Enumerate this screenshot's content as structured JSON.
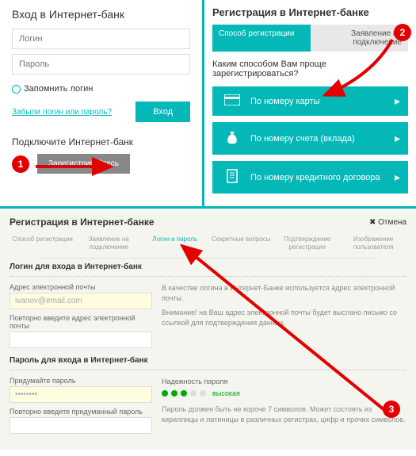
{
  "login": {
    "title": "Вход в Интернет-банк",
    "login_placeholder": "Логин",
    "password_placeholder": "Пароль",
    "remember_label": "Запомнить логин",
    "forgot_link": "Забыли логин или пароль?",
    "login_button": "Вход",
    "connect_text": "Подключите Интернет-банк",
    "register_button": "Зарегистрируйтесь"
  },
  "reg": {
    "title": "Регистрация в Интернет-банке",
    "tab1": "Способ регистрации",
    "tab2": "Заявление на подключение",
    "question": "Каким способом Вам проще зарегистрироваться?",
    "opt1": "По номеру карты",
    "opt2": "По номеру счета (вклада)",
    "opt3": "По номеру кредитного договора"
  },
  "bottom": {
    "title": "Регистрация в Интернет-банке",
    "cancel": "✖ Отмена",
    "steps": {
      "s1": "Способ регистрации",
      "s2": "Заявление на подключение",
      "s3": "Логин и пароль",
      "s4": "Секретные вопросы",
      "s5": "Подтверждение регистрации",
      "s6": "Изображение пользователя"
    },
    "login_section": "Логин для входа в Интернет-банк",
    "email_label": "Адрес электронной почты",
    "email_value": "ivanov@email.com",
    "email_repeat_label": "Повторно введите адрес электронной почты",
    "email_hint1": "В качестве логина в Интернет-Банке используется адрес электронной почты.",
    "email_hint2": "Внимание! на Ваш адрес электронной почты будет выслано письмо со ссылкой для подтверждения данных.",
    "password_section": "Пароль для входа в Интернет-банк",
    "password_label": "Придумайте пароль",
    "password_value": "••••••••",
    "password_repeat_label": "Повторно введите придуманный пароль",
    "strength_label": "Надежность пароля",
    "strength_text": "высокая",
    "password_hint": "Пароль должен быть не короче 7 символов. Может состоять из кириллицы и латиницы в различных регистрах, цифр и прочих символов."
  },
  "badges": {
    "b1": "1",
    "b2": "2",
    "b3": "3"
  }
}
